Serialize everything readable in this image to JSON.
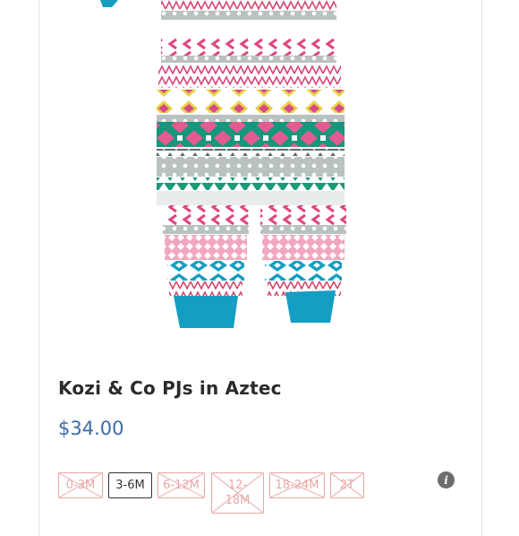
{
  "product": {
    "title": "Kozi & Co PJs in Aztec",
    "price": "$34.00",
    "image_description_icon": "pajama-photo",
    "sizes": [
      {
        "label": "0-3M",
        "available": false
      },
      {
        "label": "3-6M",
        "available": true
      },
      {
        "label": "6-12M",
        "available": false
      },
      {
        "label": "12-\n18M",
        "available": false
      },
      {
        "label": "18-24M",
        "available": false
      },
      {
        "label": "2T",
        "available": false
      }
    ]
  },
  "info_icon": {
    "glyph": "i",
    "name": "info-icon"
  },
  "colors": {
    "price": "#3e69a8",
    "sold_out": "#e8a7a4",
    "teal_cuff": "#139ec2",
    "pink": "#e0457f",
    "green": "#1a9a78"
  }
}
